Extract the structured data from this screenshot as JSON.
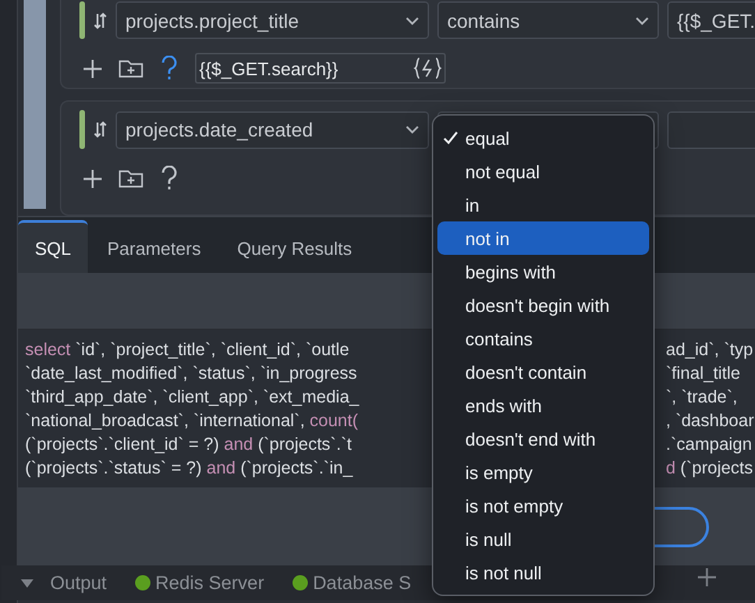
{
  "conditions": [
    {
      "field": "projects.project_title",
      "operator": "contains",
      "value_preview": "{{$_GET.",
      "value": "{{$_GET.search}}",
      "help_active": true
    },
    {
      "field": "projects.date_created",
      "help_active": false
    }
  ],
  "tabs": [
    {
      "label": "SQL",
      "selected": true
    },
    {
      "label": "Parameters",
      "selected": false
    },
    {
      "label": "Query Results",
      "selected": false
    }
  ],
  "sql_lines": [
    {
      "left": [
        {
          "t": "select",
          "kw": true
        },
        {
          "t": " `id`, `project_title`, `client_id`, `outle",
          "kw": false
        }
      ],
      "right": [
        {
          "t": "ad_id`, `typ",
          "kw": false
        }
      ]
    },
    {
      "left": [
        {
          "t": "`date_last_modified`, `status`, `in_progress",
          "kw": false
        }
      ],
      "right": [
        {
          "t": "`final_title",
          "kw": false
        }
      ]
    },
    {
      "left": [
        {
          "t": "`third_app_date`, `client_app`, `ext_media_",
          "kw": false
        }
      ],
      "right": [
        {
          "t": "`, `trade`,",
          "kw": false
        }
      ]
    },
    {
      "left": [
        {
          "t": "`national_broadcast`, `international`, ",
          "kw": false
        },
        {
          "t": "count(",
          "kw": true
        }
      ],
      "right": [
        {
          "t": ", `dashboar",
          "kw": false
        }
      ]
    },
    {
      "left": [
        {
          "t": "(`projects`.`client_id` = ?) ",
          "kw": false
        },
        {
          "t": "and",
          "kw": true
        },
        {
          "t": " (`projects`.`t",
          "kw": false
        }
      ],
      "right": [
        {
          "t": ".`campaign",
          "kw": false
        }
      ]
    },
    {
      "left": [
        {
          "t": "(`projects`.`status` = ?) ",
          "kw": false
        },
        {
          "t": "and",
          "kw": true
        },
        {
          "t": " (`projects`.`in_",
          "kw": false
        }
      ],
      "right": [
        {
          "t": "d",
          "kw": true
        },
        {
          "t": " (`projects",
          "kw": false
        }
      ]
    }
  ],
  "status_bar": [
    {
      "label": "Output",
      "kind": "panel"
    },
    {
      "label": "Redis Server",
      "kind": "service",
      "color": "#5a9e1f"
    },
    {
      "label": "Database S",
      "kind": "service",
      "color": "#5a9e1f"
    }
  ],
  "operator_menu": [
    {
      "label": "equal",
      "checked": true,
      "highlighted": false
    },
    {
      "label": "not equal",
      "checked": false,
      "highlighted": false
    },
    {
      "label": "in",
      "checked": false,
      "highlighted": false
    },
    {
      "label": "not in",
      "checked": false,
      "highlighted": true
    },
    {
      "label": "begins with",
      "checked": false,
      "highlighted": false
    },
    {
      "label": "doesn't begin with",
      "checked": false,
      "highlighted": false
    },
    {
      "label": "contains",
      "checked": false,
      "highlighted": false
    },
    {
      "label": "doesn't contain",
      "checked": false,
      "highlighted": false
    },
    {
      "label": "ends with",
      "checked": false,
      "highlighted": false
    },
    {
      "label": "doesn't end with",
      "checked": false,
      "highlighted": false
    },
    {
      "label": "is empty",
      "checked": false,
      "highlighted": false
    },
    {
      "label": "is not empty",
      "checked": false,
      "highlighted": false
    },
    {
      "label": "is null",
      "checked": false,
      "highlighted": false
    },
    {
      "label": "is not null",
      "checked": false,
      "highlighted": false
    }
  ]
}
